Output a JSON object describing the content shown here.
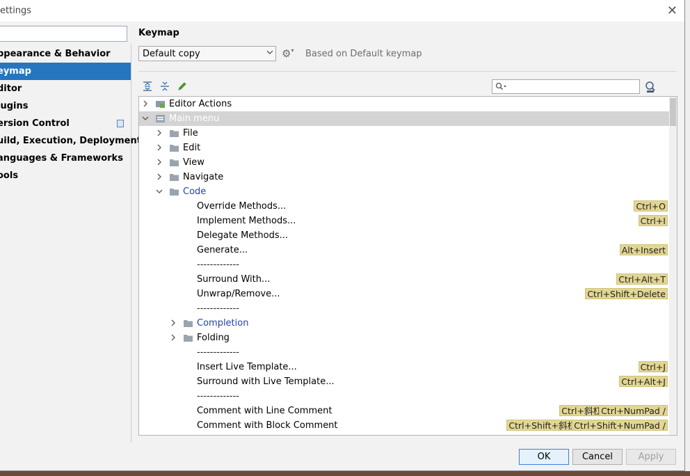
{
  "window": {
    "title": "ettings",
    "close_glyph": "✕"
  },
  "sidebar": {
    "search_value": "",
    "items": [
      {
        "label": "ppearance & Behavior"
      },
      {
        "label": "eymap"
      },
      {
        "label": "ditor"
      },
      {
        "label": "lugins"
      },
      {
        "label": "ersion Control"
      },
      {
        "label": "uild, Execution, Deployment"
      },
      {
        "label": "anguages & Frameworks"
      },
      {
        "label": "ools"
      }
    ]
  },
  "keymap": {
    "title": "Keymap",
    "selected_keymap": "Default copy",
    "based_on": "Based on Default keymap",
    "search_value": ""
  },
  "tree": {
    "rows": [
      {
        "label": "Editor Actions"
      },
      {
        "label": "Main menu"
      },
      {
        "label": "File"
      },
      {
        "label": "Edit"
      },
      {
        "label": "View"
      },
      {
        "label": "Navigate"
      },
      {
        "label": "Code"
      },
      {
        "label": "Override Methods...",
        "shortcuts": [
          "Ctrl+O"
        ]
      },
      {
        "label": "Implement Methods...",
        "shortcuts": [
          "Ctrl+I"
        ]
      },
      {
        "label": "Delegate Methods..."
      },
      {
        "label": "Generate...",
        "shortcuts": [
          "Alt+Insert"
        ]
      },
      {
        "label": "-------------"
      },
      {
        "label": "Surround With...",
        "shortcuts": [
          "Ctrl+Alt+T"
        ]
      },
      {
        "label": "Unwrap/Remove...",
        "shortcuts": [
          "Ctrl+Shift+Delete"
        ]
      },
      {
        "label": "-------------"
      },
      {
        "label": "Completion"
      },
      {
        "label": "Folding"
      },
      {
        "label": "-------------"
      },
      {
        "label": "Insert Live Template...",
        "shortcuts": [
          "Ctrl+J"
        ]
      },
      {
        "label": "Surround with Live Template...",
        "shortcuts": [
          "Ctrl+Alt+J"
        ]
      },
      {
        "label": "-------------"
      },
      {
        "label": "Comment with Line Comment",
        "shortcuts": [
          "Ctrl+斜杠",
          "Ctrl+NumPad /"
        ]
      },
      {
        "label": "Comment with Block Comment",
        "shortcuts": [
          "Ctrl+Shift+斜杠",
          "Ctrl+Shift+NumPad /"
        ]
      }
    ]
  },
  "buttons": {
    "ok": "OK",
    "cancel": "Cancel",
    "apply": "Apply"
  },
  "colors": {
    "selection": "#2675bf",
    "shortcut_bg": "#e2d693",
    "link": "#2340b8"
  }
}
